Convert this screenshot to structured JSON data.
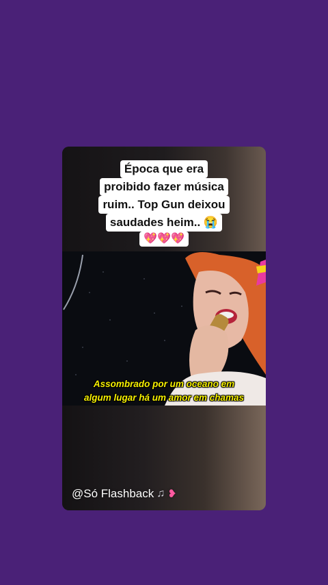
{
  "overlay_caption": {
    "lines": [
      "Época que era",
      "proibido fazer música",
      "ruim.. Top Gun deixou",
      "saudades heim.. 😭"
    ],
    "hearts": [
      "💖",
      "💖",
      "💖"
    ]
  },
  "video": {
    "subtitles": [
      "Assombrado por um oceano em",
      "algum lugar há um amor em chamas"
    ]
  },
  "footer": {
    "handle": "@Só Flashback",
    "icons": [
      "music-note-icon",
      "heart-with-arrow-icon"
    ]
  },
  "colors": {
    "background": "#4a2177",
    "subtitle": "#f6f000",
    "caption_bg": "#ffffff"
  }
}
